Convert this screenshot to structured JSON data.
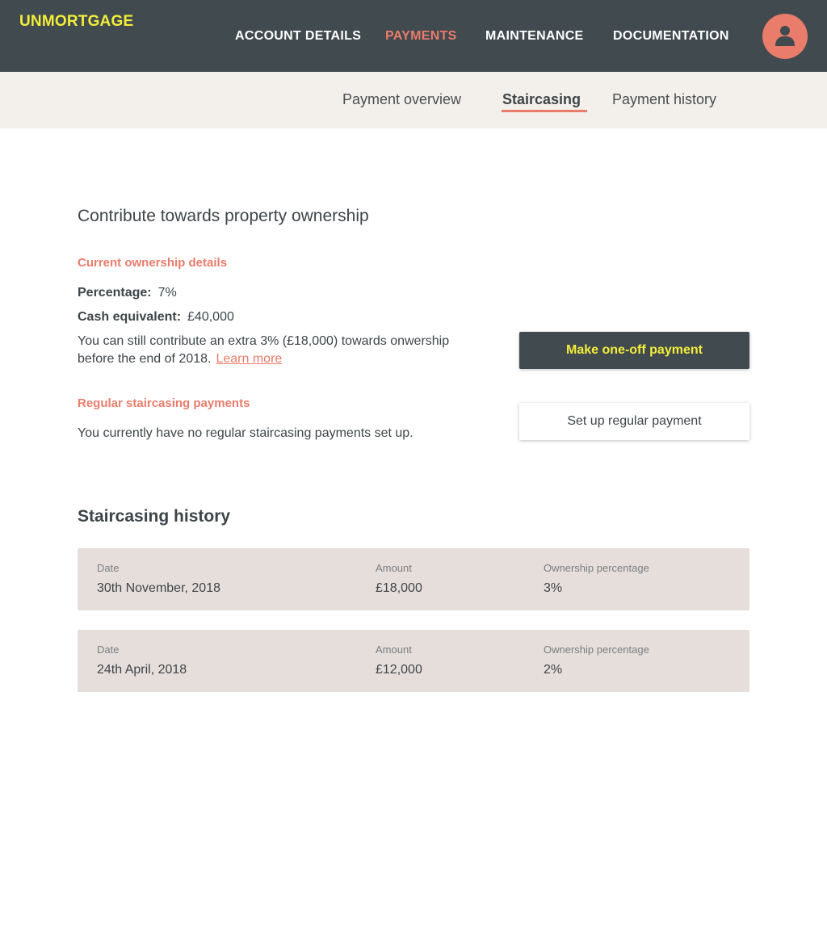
{
  "app": {
    "logo": "UNMORTGAGE"
  },
  "nav": {
    "items": [
      {
        "label": "ACCOUNT DETAILS",
        "active": false
      },
      {
        "label": "PAYMENTS",
        "active": true
      },
      {
        "label": "MAINTENANCE",
        "active": false
      },
      {
        "label": "DOCUMENTATION",
        "active": false
      }
    ],
    "avatar_icon": "user-icon"
  },
  "subnav": {
    "items": [
      {
        "label": "Payment overview",
        "active": false
      },
      {
        "label": "Staircasing",
        "active": true
      },
      {
        "label": "Payment history",
        "active": false
      }
    ]
  },
  "main": {
    "title": "Contribute towards property ownership",
    "ownership": {
      "heading": "Current ownership details",
      "percentage_label": "Percentage:",
      "percentage_value": "7%",
      "cash_label": "Cash equivalent:",
      "cash_value": "£40,000",
      "contribute_text": "You can still contribute an extra 3% (£18,000) towards onwership before the end of 2018.",
      "learn_more": "Learn more"
    },
    "regular": {
      "heading": "Regular staircasing payments",
      "text": "You currently have no regular staircasing payments set up."
    },
    "buttons": {
      "one_off": "Make one-off payment",
      "regular": "Set up regular payment"
    }
  },
  "history": {
    "title": "Staircasing history",
    "columns": [
      "Date",
      "Amount",
      "Ownership percentage"
    ],
    "rows": [
      {
        "date": "30th November, 2018",
        "amount": "£18,000",
        "percentage": "3%"
      },
      {
        "date": "24th April, 2018",
        "amount": "£12,000",
        "percentage": "2%"
      }
    ]
  },
  "colors": {
    "topbar": "#414a4f",
    "accent": "#e97c6b",
    "logo": "#f3ee3a",
    "subbar": "#f3efeb",
    "row_bg": "#e6dedb"
  }
}
